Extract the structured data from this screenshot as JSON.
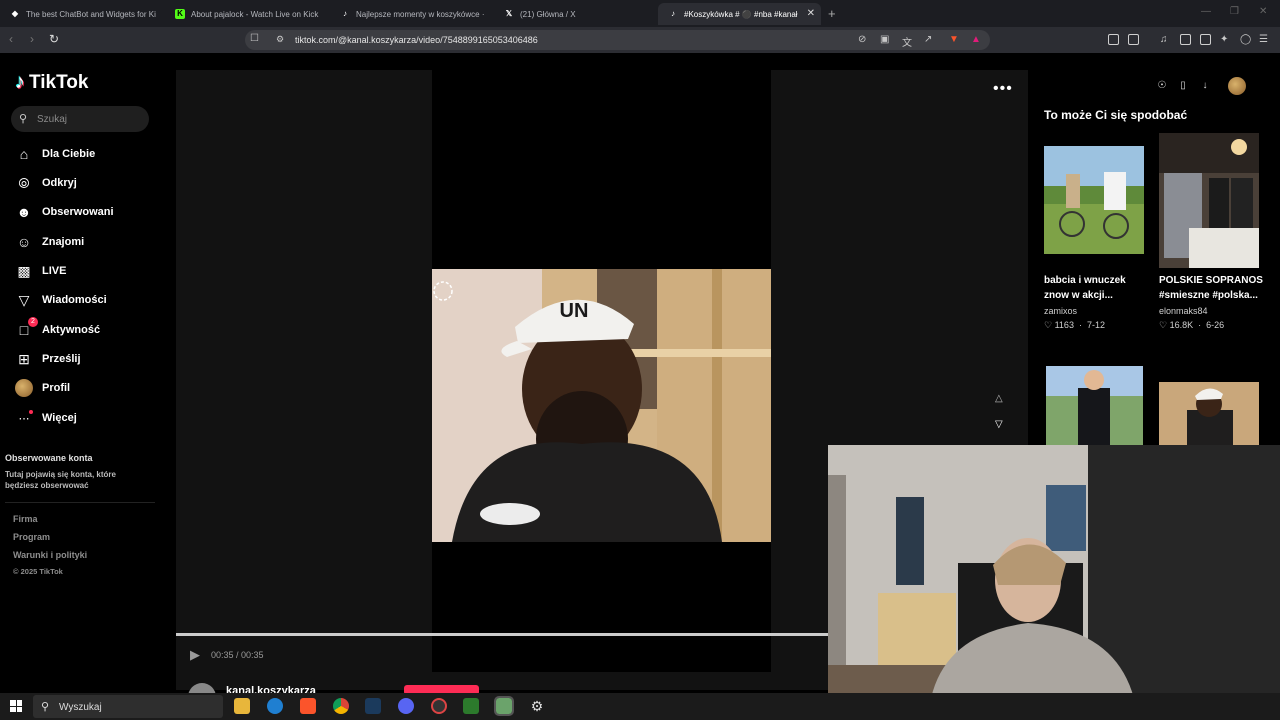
{
  "browser": {
    "tabs": [
      {
        "title": "The best ChatBot and Widgets for Ki"
      },
      {
        "title": "About pajalock - Watch Live on Kick"
      },
      {
        "title": "Najlepsze momenty w koszykówce ·"
      },
      {
        "title": "(21) Główna / X"
      },
      {
        "title": "#Koszykówka # ⚫ #nba #kanał"
      }
    ],
    "new_tab": "+",
    "url": "tiktok.com/@kanal.koszykarza/video/7548899165053406486"
  },
  "tiktok": {
    "logo": "TikTok",
    "search_placeholder": "Szukaj",
    "nav": [
      {
        "label": "Dla Ciebie",
        "icon": "home-icon"
      },
      {
        "label": "Odkryj",
        "icon": "compass-icon"
      },
      {
        "label": "Obserwowani",
        "icon": "following-icon"
      },
      {
        "label": "Znajomi",
        "icon": "friends-icon"
      },
      {
        "label": "LIVE",
        "icon": "live-icon"
      },
      {
        "label": "Wiadomości",
        "icon": "messages-icon"
      },
      {
        "label": "Aktywność",
        "icon": "activity-icon",
        "badge": "2"
      },
      {
        "label": "Prześlij",
        "icon": "upload-icon"
      },
      {
        "label": "Profil",
        "icon": "profile-avatar"
      },
      {
        "label": "Więcej",
        "icon": "more-icon"
      }
    ],
    "followed_heading": "Obserwowane konta",
    "followed_sub": "Tutaj pojawią się konta, które będziesz obserwować",
    "footer": [
      "Firma",
      "Program",
      "Warunki i polityki"
    ],
    "copyright": "© 2025 TikTok",
    "video": {
      "time": "00:35 / 00:35",
      "author": "kanal.koszykarza",
      "more": "•••",
      "progress": 1.0
    },
    "recommend": {
      "title": "To może Ci się spodobać",
      "items": [
        {
          "caption": "babcia i wnuczek znow w akcji...",
          "user": "zamixos",
          "likes": "1163",
          "date": "7-12"
        },
        {
          "caption": "POLSKIE SOPRANOS #smieszne #polska...",
          "user": "elonmaks84",
          "likes": "16.8K",
          "date": "6-26"
        }
      ]
    }
  },
  "taskbar": {
    "search": "Wyszukaj"
  },
  "colors": {
    "accent": "#fe2c55",
    "bg": "#000000",
    "chrome": "#2c2d33"
  }
}
